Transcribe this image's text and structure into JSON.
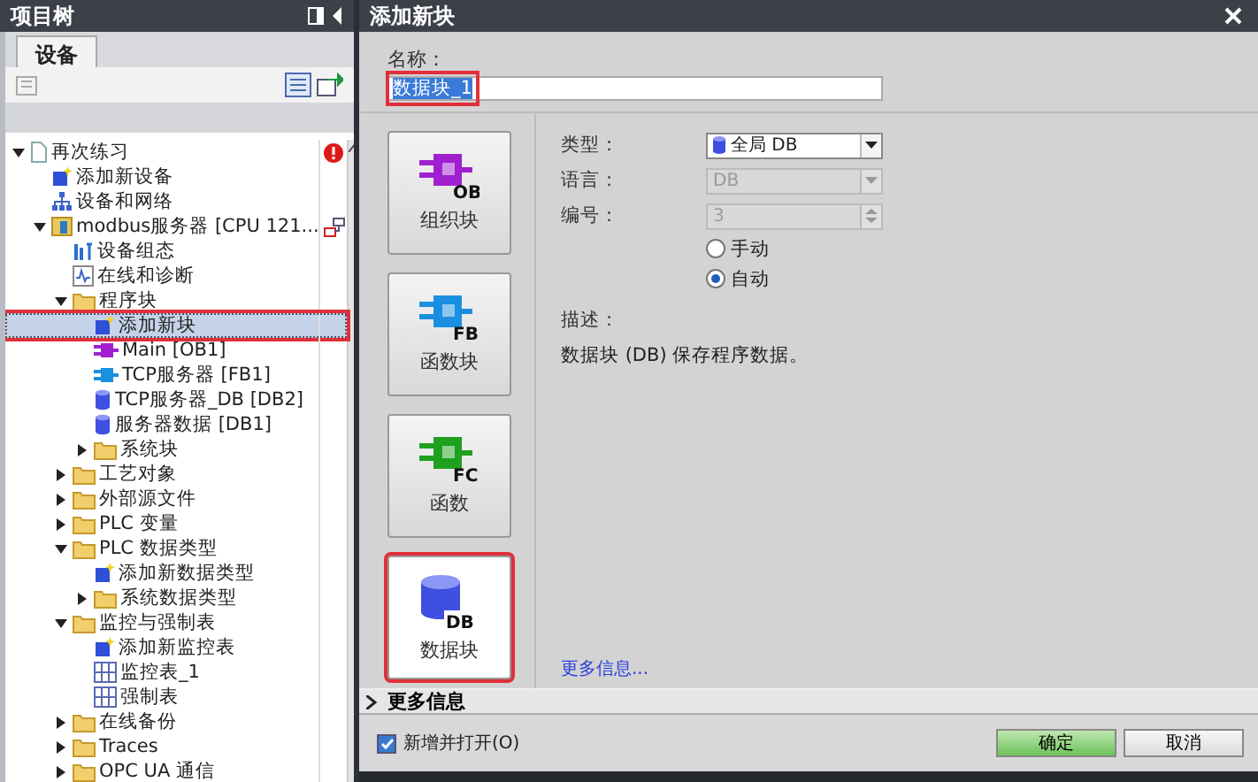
{
  "project_tree": {
    "title": "项目树",
    "tabs": [
      {
        "label": "设备",
        "selected": true
      }
    ],
    "items": [
      {
        "label": "再次练习",
        "kind": "document",
        "expanded": true,
        "selected": false,
        "children": [
          {
            "label": "添加新设备",
            "kind": "add",
            "selected": false
          },
          {
            "label": "设备和网络",
            "kind": "network",
            "selected": false
          },
          {
            "label": "modbus服务器 [CPU 121...",
            "kind": "device",
            "expanded": true,
            "selected": false,
            "children": [
              {
                "label": "设备组态",
                "kind": "config",
                "selected": false
              },
              {
                "label": "在线和诊断",
                "kind": "diag",
                "selected": false
              },
              {
                "label": "程序块",
                "kind": "folder",
                "expanded": true,
                "selected": false,
                "children": [
                  {
                    "label": "添加新块",
                    "kind": "add",
                    "selected": true
                  },
                  {
                    "label": "Main [OB1]",
                    "kind": "ob",
                    "selected": false
                  },
                  {
                    "label": "TCP服务器 [FB1]",
                    "kind": "fb",
                    "selected": false
                  },
                  {
                    "label": "TCP服务器_DB [DB2]",
                    "kind": "db",
                    "selected": false
                  },
                  {
                    "label": "服务器数据 [DB1]",
                    "kind": "db",
                    "selected": false
                  },
                  {
                    "label": "系统块",
                    "kind": "folder",
                    "expanded": false,
                    "selected": false
                  }
                ]
              },
              {
                "label": "工艺对象",
                "kind": "folder",
                "expanded": false,
                "selected": false
              },
              {
                "label": "外部源文件",
                "kind": "folder",
                "expanded": false,
                "selected": false
              },
              {
                "label": "PLC 变量",
                "kind": "folder",
                "expanded": false,
                "selected": false
              },
              {
                "label": "PLC 数据类型",
                "kind": "folder",
                "expanded": true,
                "selected": false,
                "children": [
                  {
                    "label": "添加新数据类型",
                    "kind": "add",
                    "selected": false
                  },
                  {
                    "label": "系统数据类型",
                    "kind": "folder",
                    "expanded": false,
                    "selected": false
                  }
                ]
              },
              {
                "label": "监控与强制表",
                "kind": "folder",
                "expanded": true,
                "selected": false,
                "children": [
                  {
                    "label": "添加新监控表",
                    "kind": "add",
                    "selected": false
                  },
                  {
                    "label": "监控表_1",
                    "kind": "table",
                    "selected": false
                  },
                  {
                    "label": "强制表",
                    "kind": "table",
                    "selected": false
                  }
                ]
              },
              {
                "label": "在线备份",
                "kind": "folder",
                "expanded": false,
                "selected": false
              },
              {
                "label": "Traces",
                "kind": "folder",
                "expanded": false,
                "selected": false
              },
              {
                "label": "OPC UA 通信",
                "kind": "folder",
                "expanded": false,
                "selected": false
              }
            ]
          }
        ]
      }
    ]
  },
  "dialog": {
    "title": "添加新块",
    "name_label": "名称：",
    "name_value": "数据块_1",
    "block_types": [
      {
        "kind": "block",
        "code": "OB",
        "label": "组织块",
        "color": "#a020d0",
        "selected": false
      },
      {
        "kind": "block",
        "code": "FB",
        "label": "函数块",
        "color": "#1a8fe0",
        "selected": false
      },
      {
        "kind": "block",
        "code": "FC",
        "label": "函数",
        "color": "#1fa020",
        "selected": false
      },
      {
        "kind": "cylinder",
        "code": "DB",
        "label": "数据块",
        "color": "#3f4fe0",
        "selected": true
      }
    ],
    "fields": [
      {
        "label": "类型：",
        "kind": "select",
        "value": "全局 DB",
        "disabled": false
      },
      {
        "label": "语言：",
        "kind": "select",
        "value": "DB",
        "disabled": true
      },
      {
        "label": "编号：",
        "kind": "spin",
        "value": "3",
        "disabled": true
      }
    ],
    "radios": [
      {
        "label": "手动",
        "selected": false
      },
      {
        "label": "自动",
        "selected": true
      }
    ],
    "description_label": "描述：",
    "description": "数据块 (DB) 保存程序数据。",
    "more_info_link": "更多信息...",
    "more_info_section": {
      "label": "更多信息",
      "expanded": false
    },
    "open_checkbox": {
      "label": "新增并打开(O)",
      "checked": true
    },
    "buttons": [
      {
        "label": "确定",
        "kind": "primary"
      },
      {
        "label": "取消",
        "kind": "normal"
      }
    ]
  }
}
